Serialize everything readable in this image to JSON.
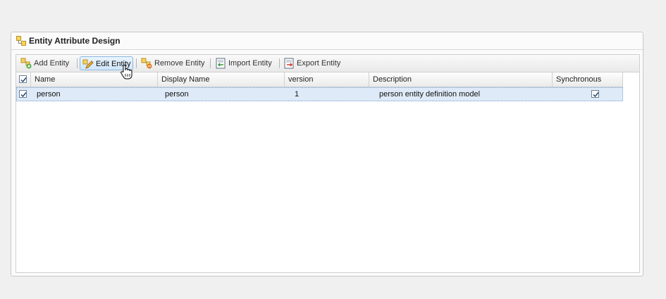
{
  "panel": {
    "title": "Entity Attribute Design"
  },
  "toolbar": {
    "add_label": "Add Entity",
    "edit_label": "Edit Entity",
    "remove_label": "Remove Entity",
    "import_label": "Import Entity",
    "export_label": "Export Entity"
  },
  "grid": {
    "columns": [
      "Name",
      "Display Name",
      "version",
      "Description",
      "Synchronous"
    ],
    "rows": [
      {
        "name": "person",
        "display_name": "person",
        "version": "1",
        "description": "person entity definition model",
        "synchronous": true,
        "selected": true
      }
    ]
  },
  "icons": {
    "panel": "entity-blocks-icon",
    "add": "add-entity-icon",
    "edit": "edit-pencil-icon",
    "remove": "remove-entity-icon",
    "import": "import-icon",
    "export": "export-icon",
    "cursor": "hand-pointer-icon"
  },
  "colors": {
    "selection": "#dfeaf8",
    "active_button": "#cfe6fb",
    "border": "#cfcfcf"
  }
}
